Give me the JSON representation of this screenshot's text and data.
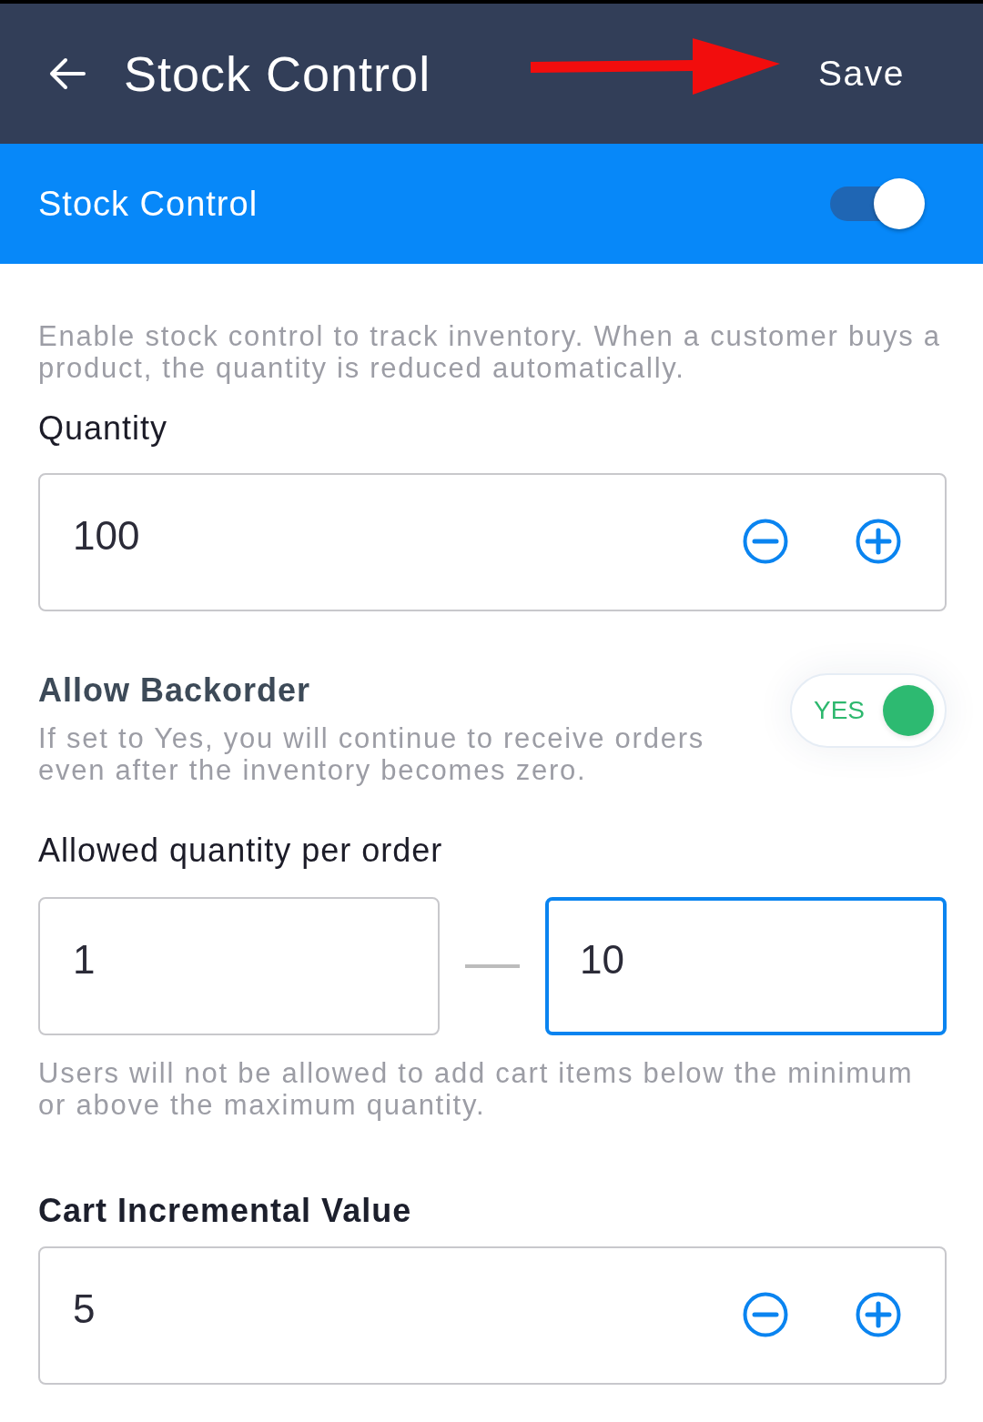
{
  "header": {
    "title": "Stock Control",
    "save_label": "Save"
  },
  "stock_control": {
    "label": "Stock Control",
    "on": true
  },
  "description": "Enable stock control to track inventory. When a customer buys a product, the quantity is reduced automatically.",
  "quantity": {
    "label": "Quantity",
    "value": "100"
  },
  "backorder": {
    "title": "Allow Backorder",
    "description": "If set to Yes, you will continue to receive orders even after the inventory becomes zero.",
    "toggle_label": "YES",
    "on": true
  },
  "allowed_quantity": {
    "label": "Allowed quantity per order",
    "min": {
      "value": "1",
      "focused": false
    },
    "max": {
      "value": "10",
      "focused": true
    },
    "hint": "Users will not be allowed to add cart items below the minimum or above the maximum quantity."
  },
  "cart_increment": {
    "label": "Cart Incremental Value",
    "value": "5"
  }
}
